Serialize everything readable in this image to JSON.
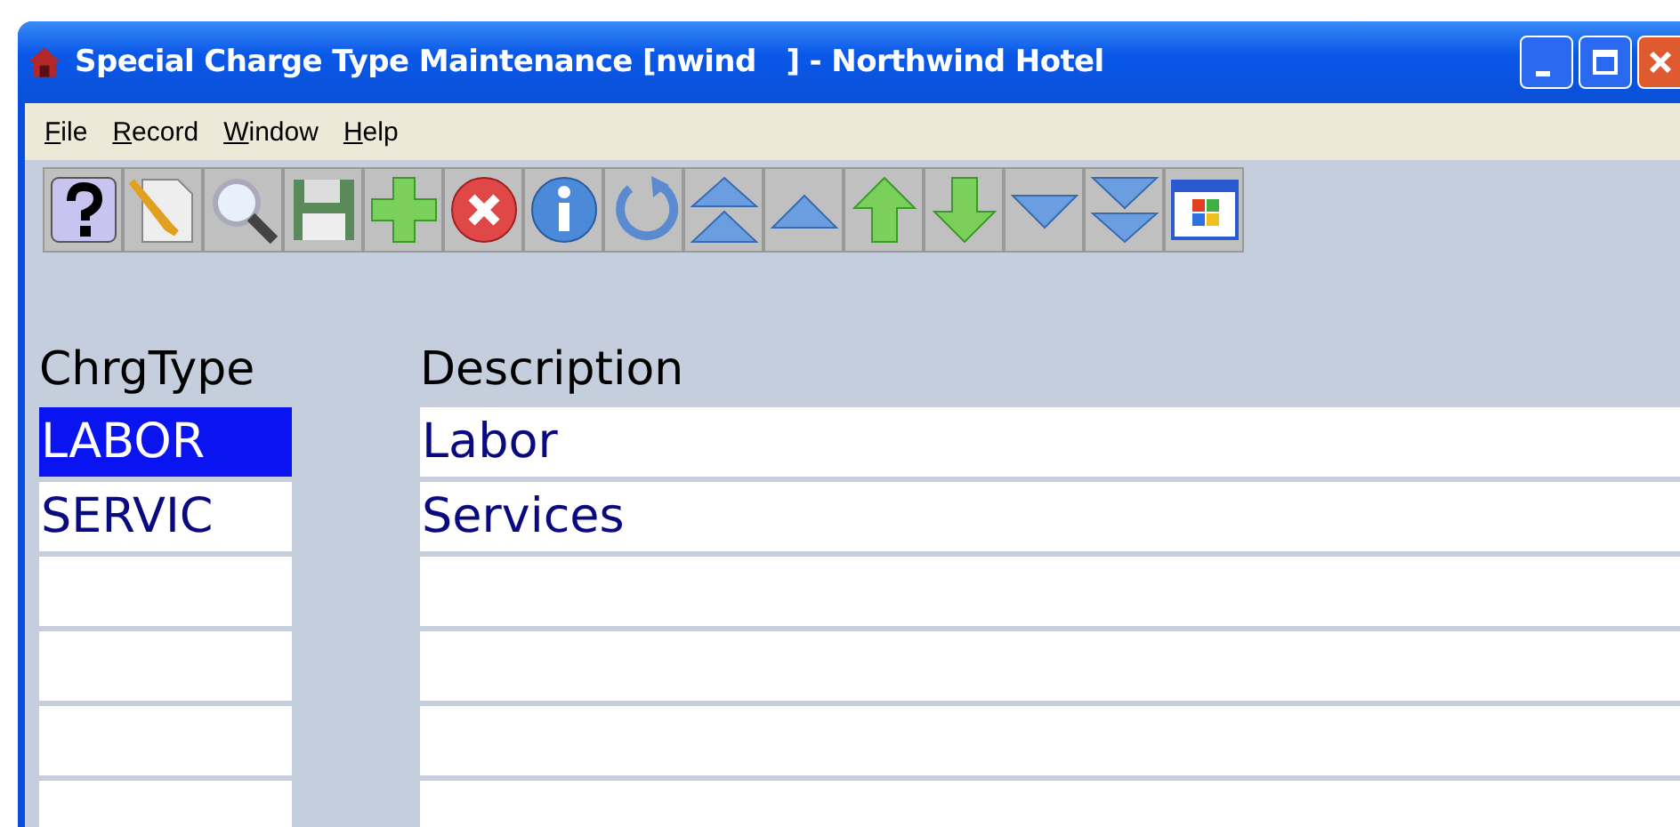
{
  "window": {
    "title": "Special Charge Type Maintenance [nwind   ] - Northwind Hotel"
  },
  "menu": [
    "File",
    "Record",
    "Window",
    "Help"
  ],
  "toolbar": [
    {
      "kind": "help"
    },
    {
      "kind": "new"
    },
    {
      "kind": "search"
    },
    {
      "kind": "save"
    },
    {
      "kind": "add"
    },
    {
      "kind": "delete"
    },
    {
      "kind": "info"
    },
    {
      "kind": "refresh"
    },
    {
      "kind": "first"
    },
    {
      "kind": "prev-page"
    },
    {
      "kind": "prev"
    },
    {
      "kind": "next"
    },
    {
      "kind": "next-page"
    },
    {
      "kind": "last"
    },
    {
      "kind": "window"
    }
  ],
  "table": {
    "columns": [
      "ChrgType",
      "Description"
    ],
    "rows": [
      {
        "cells": [
          "LABOR",
          "Labor"
        ],
        "selected": true
      },
      {
        "cells": [
          "SERVIC",
          "Services"
        ],
        "selected": false
      }
    ]
  }
}
